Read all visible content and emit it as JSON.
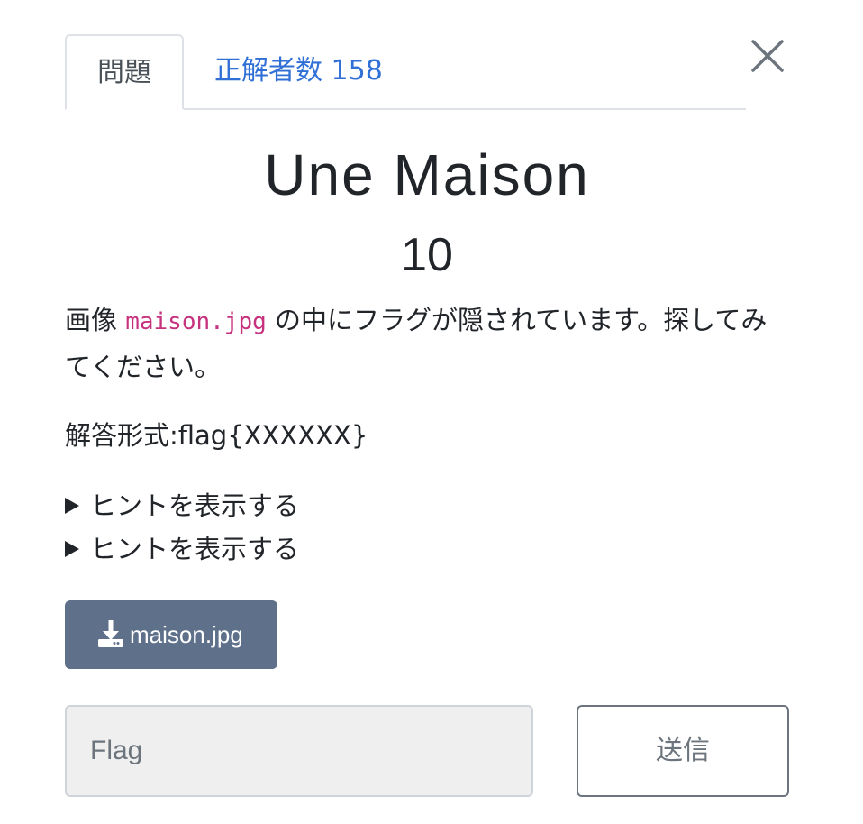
{
  "tabs": {
    "challenge_label": "問題",
    "solves_label": "正解者数 158"
  },
  "challenge": {
    "name": "Une Maison",
    "value": "10",
    "description_before": "画像 ",
    "description_code": "maison.jpg",
    "description_after": " の中にフラグが隠されています。探してみてください。",
    "format_text": "解答形式:flag{XXXXXX}"
  },
  "hints": [
    {
      "label": "ヒントを表示する"
    },
    {
      "label": "ヒントを表示する"
    }
  ],
  "files": [
    {
      "name": "maison.jpg",
      "icon": "download-icon"
    }
  ],
  "submission": {
    "placeholder": "Flag",
    "value": "",
    "submit_label": "送信"
  },
  "colors": {
    "link": "#2f6fd6",
    "code": "#c7327f",
    "download_button": "#5e708a",
    "input_background": "#efefef"
  }
}
